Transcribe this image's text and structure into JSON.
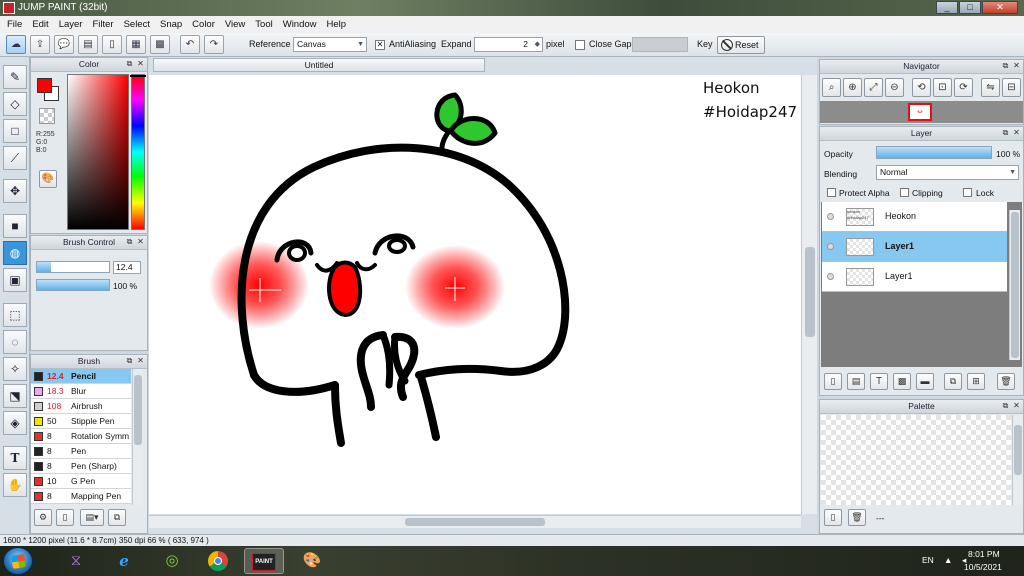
{
  "window": {
    "title": "JUMP PAINT (32bit)",
    "buttons": {
      "minimize": "_",
      "maximize": "□",
      "close": "✕"
    }
  },
  "menu": [
    "File",
    "Edit",
    "Layer",
    "Filter",
    "Select",
    "Snap",
    "Color",
    "View",
    "Tool",
    "Window",
    "Help"
  ],
  "toolbar": {
    "reference_label": "Reference",
    "reference_value": "Canvas",
    "antialiasing_label": "AntiAliasing",
    "antialiasing_checked": "✕",
    "expand_label": "Expand",
    "expand_value": "2",
    "expand_unit": "pixel",
    "close_gaps_label": "Close Gaps",
    "key_label": "Key",
    "reset_label": "Reset"
  },
  "color_panel": {
    "title": "Color",
    "primary": "#ff0000",
    "secondary": "#ffffff",
    "r": "R:255",
    "g": "G:0",
    "b": "B:0"
  },
  "brush_control": {
    "title": "Brush Control",
    "size": "12.4",
    "size_fraction": 0.2,
    "opacity": "100 %",
    "opacity_fraction": 1.0
  },
  "brush_panel": {
    "title": "Brush",
    "items": [
      {
        "size": "12.4",
        "name": "Pencil",
        "color": "#222222",
        "selected": true
      },
      {
        "size": "18.3",
        "name": "Blur",
        "color": "#f2a8e8"
      },
      {
        "size": "108",
        "name": "Airbrush",
        "color": "#cfcfcf"
      },
      {
        "size": "50",
        "name": "Stipple Pen",
        "color": "#f2e600"
      },
      {
        "size": "8",
        "name": "Rotation Symm",
        "color": "#e33030"
      },
      {
        "size": "8",
        "name": "Pen",
        "color": "#222222"
      },
      {
        "size": "8",
        "name": "Pen (Sharp)",
        "color": "#222222"
      },
      {
        "size": "10",
        "name": "G Pen",
        "color": "#e33030"
      },
      {
        "size": "8",
        "name": "Mapping Pen",
        "color": "#e33030"
      }
    ]
  },
  "document": {
    "tab": "Untitled",
    "text_line1": "Heokon",
    "text_line2": "#Hoidap247"
  },
  "navigator": {
    "title": "Navigator",
    "thumb_label": "·ω·"
  },
  "layer_panel": {
    "title": "Layer",
    "opacity_label": "Opacity",
    "opacity_value": "100 %",
    "opacity_fraction": 1.0,
    "blending_label": "Blending",
    "blending_value": "Normal",
    "protect_alpha": "Protect Alpha",
    "clipping": "Clipping",
    "lock": "Lock",
    "layers": [
      {
        "name": "Heokon",
        "thumb": "heokon #Hoidap247"
      },
      {
        "name": "Layer1",
        "thumb": "",
        "selected": true
      },
      {
        "name": "Layer1",
        "thumb": ""
      }
    ]
  },
  "palette_panel": {
    "title": "Palette",
    "footer_text": "---"
  },
  "statusbar": {
    "text": "1600 * 1200 pixel  (11.6 * 8.7cm)  350 dpi  66 %  ( 633, 974 )"
  },
  "taskbar": {
    "lang": "EN",
    "time": "8:01 PM",
    "date": "10/5/2021",
    "jump_paint_label": "PAINT"
  }
}
